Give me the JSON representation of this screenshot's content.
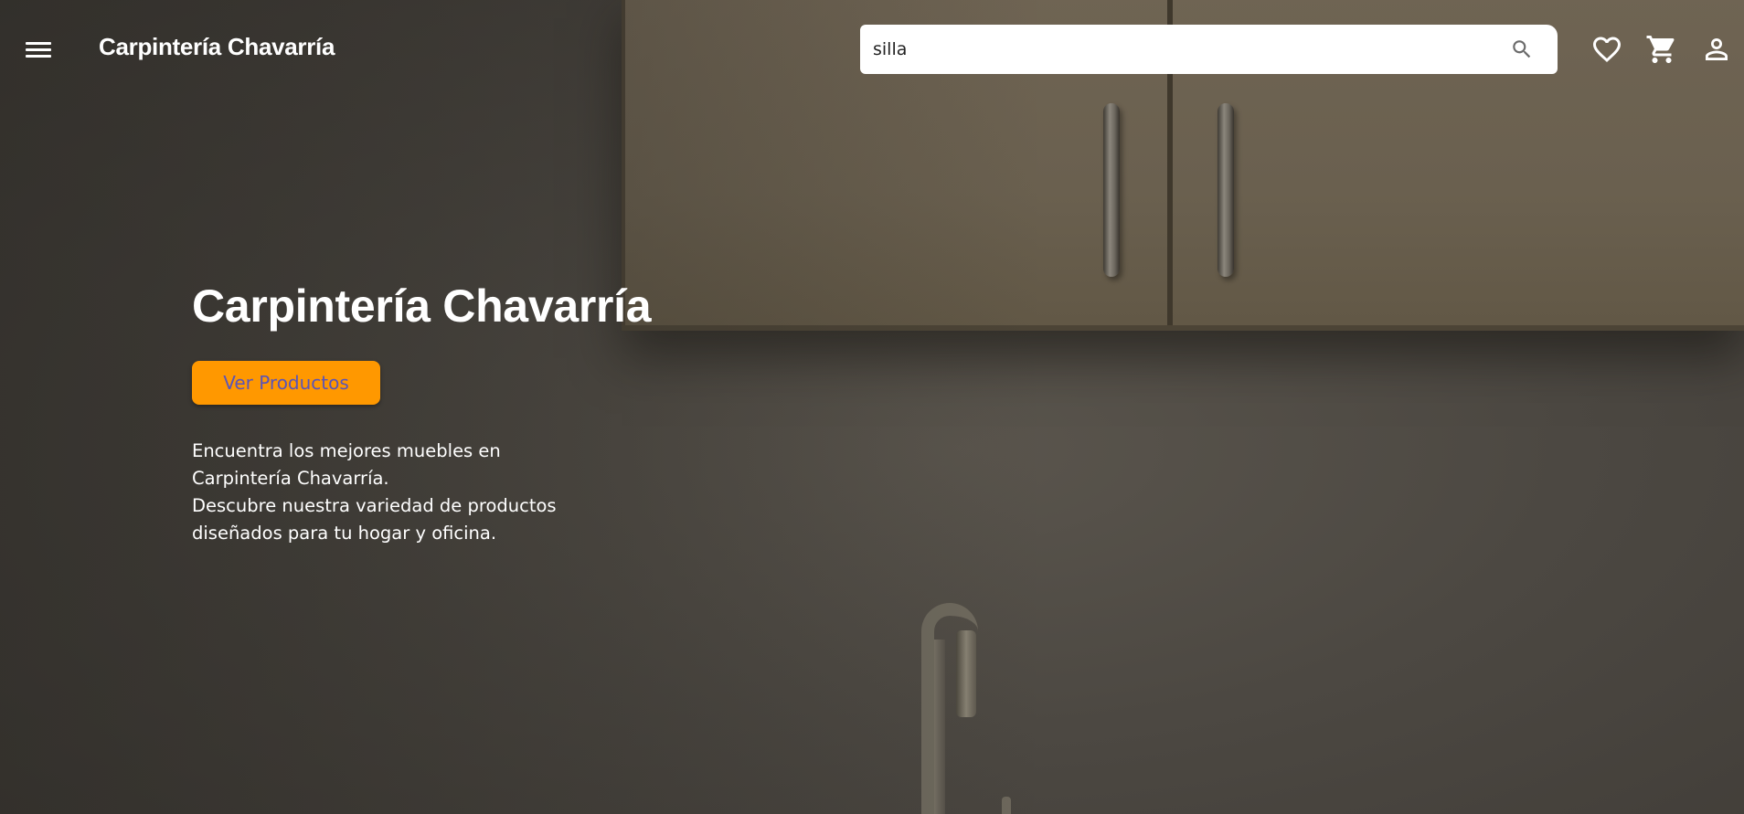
{
  "header": {
    "brand": "Carpintería Chavarría",
    "search": {
      "value": "silla",
      "placeholder": ""
    },
    "icons": [
      "menu-icon",
      "search-icon",
      "heart-icon",
      "cart-icon",
      "user-icon"
    ]
  },
  "hero": {
    "title": "Carpintería Chavarría",
    "cta_label": "Ver Productos",
    "description_lines": [
      "Encuentra los mejores muebles en",
      "Carpintería Chavarría.",
      "Descubre nuestra variedad de productos",
      "diseñados para tu hogar y oficina."
    ]
  },
  "colors": {
    "accent": "#ff9800",
    "cta_text": "#5a54b8",
    "header_text": "#ffffff",
    "search_background": "#ffffff"
  }
}
